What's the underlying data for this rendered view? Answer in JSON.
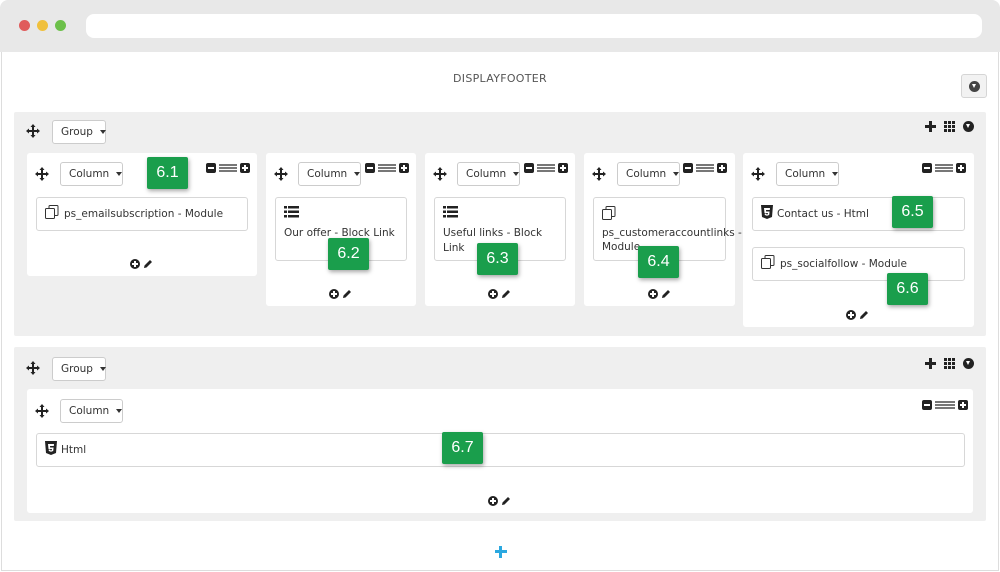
{
  "hook": {
    "title": "DISPLAYFOOTER"
  },
  "labels": {
    "group": "Group",
    "column": "Column"
  },
  "modules": {
    "m1": "ps_emailsubscription - Module",
    "m2": "Our offer - Block Link",
    "m3": "Useful links - Block Link",
    "m4": "ps_customeraccountlinks - Module",
    "m5": "Contact us - Html",
    "m6": "ps_socialfollow - Module",
    "m7": "Html"
  },
  "badges": {
    "b1": "6.1",
    "b2": "6.2",
    "b3": "6.3",
    "b4": "6.4",
    "b5": "6.5",
    "b6": "6.6",
    "b7": "6.7"
  },
  "colors": {
    "badge": "#1a9e4c",
    "add_group": "#2aa8e0",
    "group_bg": "#efefef"
  },
  "icons": {
    "move": "move-icon",
    "copy": "copy-module-icon",
    "list": "list-icon",
    "html5": "html5-icon",
    "add": "add-icon",
    "edit": "pencil-icon",
    "grid": "grid-icon",
    "collapse": "collapse-down-icon"
  }
}
